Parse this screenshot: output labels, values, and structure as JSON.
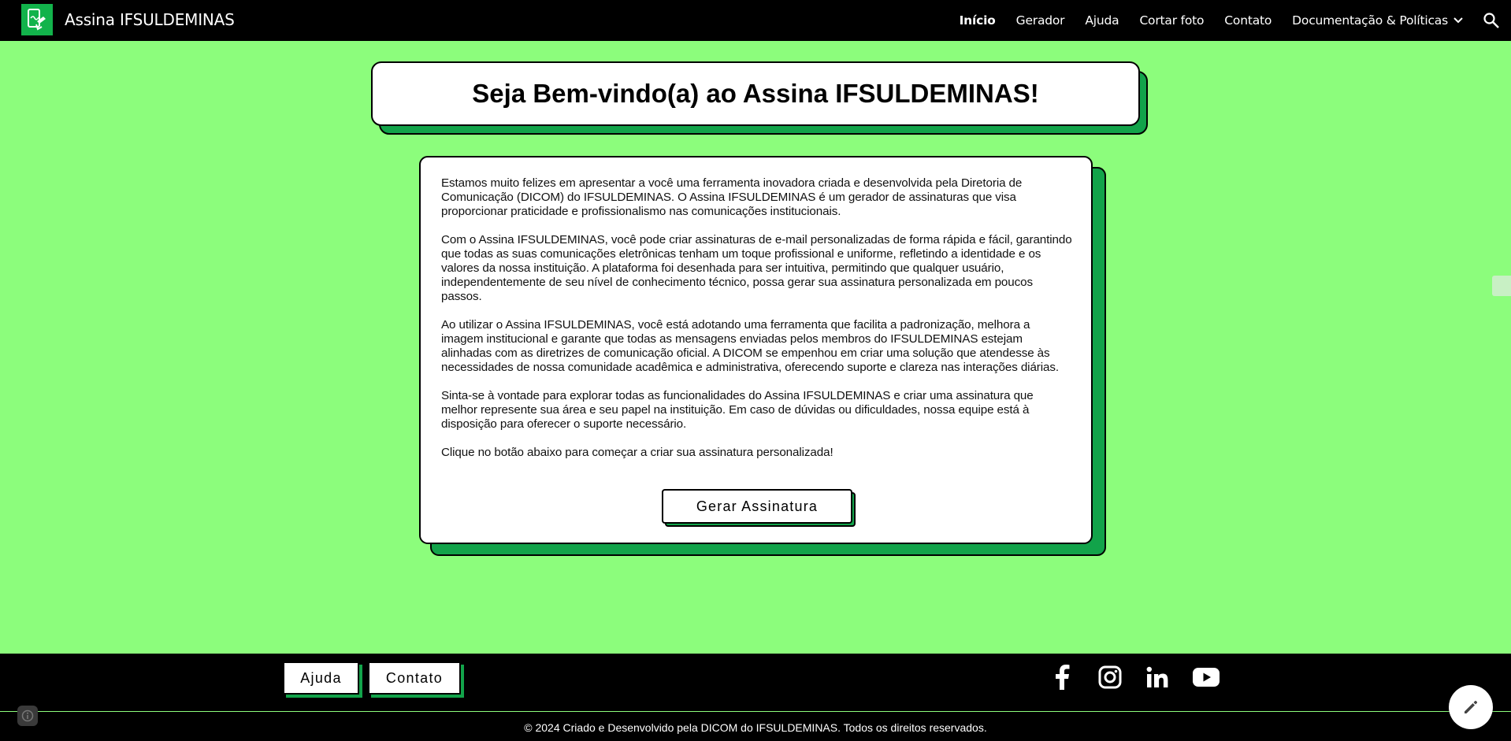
{
  "header": {
    "site_title": "Assina IFSULDEMINAS",
    "logo_icon": "signature-phone-icon",
    "nav": [
      {
        "label": "Início",
        "active": true
      },
      {
        "label": "Gerador"
      },
      {
        "label": "Ajuda"
      },
      {
        "label": "Cortar foto"
      },
      {
        "label": "Contato"
      },
      {
        "label": "Documentação & Políticas",
        "has_dropdown": true
      }
    ],
    "search_icon": "search-icon"
  },
  "hero": {
    "title": "Seja Bem-vindo(a) ao Assina IFSULDEMINAS!"
  },
  "content": {
    "paragraphs": [
      "Estamos muito felizes em apresentar a você uma ferramenta inovadora criada e desenvolvida pela Diretoria de Comunicação (DICOM) do IFSULDEMINAS. O Assina IFSULDEMINAS é um gerador de assinaturas que visa proporcionar praticidade e profissionalismo nas comunicações institucionais.",
      "Com o Assina IFSULDEMINAS, você pode criar assinaturas de e-mail personalizadas de forma rápida e fácil, garantindo que todas as suas comunicações eletrônicas tenham um toque profissional e uniforme, refletindo a identidade e os valores da nossa instituição. A plataforma foi desenhada para ser intuitiva, permitindo que qualquer usuário, independentemente de seu nível de conhecimento técnico, possa gerar sua assinatura personalizada em poucos passos.",
      "Ao utilizar o Assina IFSULDEMINAS, você está adotando uma ferramenta que facilita a padronização, melhora a imagem institucional e garante que todas as mensagens enviadas pelos membros do IFSULDEMINAS estejam alinhadas com as diretrizes de comunicação oficial. A DICOM se empenhou em criar uma solução que atendesse às necessidades de nossa comunidade acadêmica e administrativa, oferecendo suporte e clareza nas interações diárias.",
      "Sinta-se à vontade para explorar todas as funcionalidades do Assina IFSULDEMINAS e criar uma assinatura que melhor represente sua área e seu papel na instituição. Em caso de dúvidas ou dificuldades, nossa equipe está à disposição para oferecer o suporte necessário.",
      "Clique no botão abaixo para começar a criar sua assinatura personalizada!"
    ],
    "cta_label": "Gerar Assinatura"
  },
  "footer": {
    "buttons": [
      "Ajuda",
      "Contato"
    ],
    "social": [
      "facebook-icon",
      "instagram-icon",
      "linkedin-icon",
      "youtube-icon"
    ],
    "copyright": "© 2024 Criado e Desenvolvido pela DICOM do IFSULDEMINAS. Todos os direitos reservados."
  },
  "colors": {
    "background": "#8cfd7c",
    "accent": "#12a34a",
    "bar": "#000000"
  }
}
